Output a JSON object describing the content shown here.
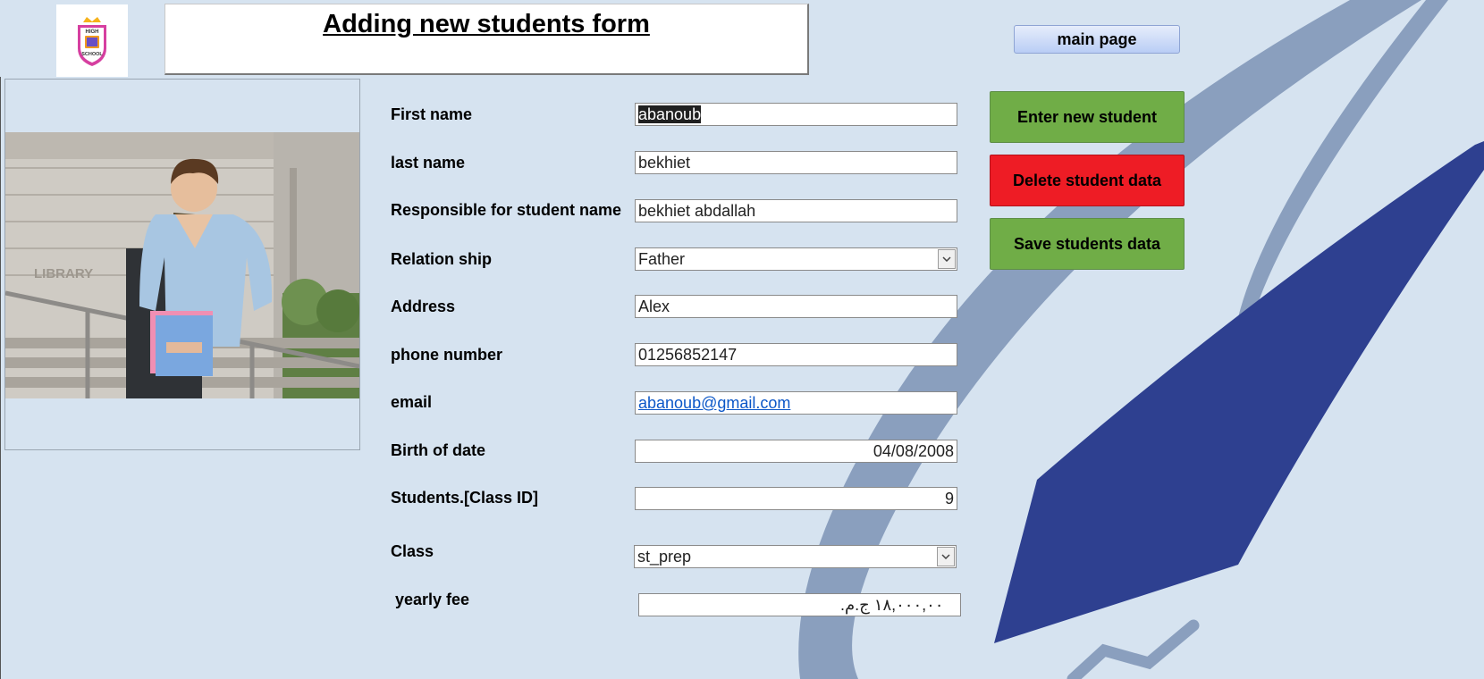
{
  "header": {
    "logo_text_top": "HIGH",
    "logo_text_bottom": "SCHOOL",
    "title": "Adding new students form",
    "main_page_label": "main page"
  },
  "photo": {
    "sign_text": "LIBRARY"
  },
  "form": {
    "first_name": {
      "label": "First name",
      "value": "abanoub"
    },
    "last_name": {
      "label": "last name",
      "value": "bekhiet"
    },
    "responsible": {
      "label": "Responsible for student name",
      "value": "bekhiet abdallah"
    },
    "relationship": {
      "label": "Relation ship",
      "value": "Father"
    },
    "address": {
      "label": "Address",
      "value": "Alex"
    },
    "phone": {
      "label": "phone number",
      "value": "01256852147"
    },
    "email": {
      "label": "email",
      "value": "abanoub@gmail.com"
    },
    "birth_date": {
      "label": "Birth of date",
      "value": "04/08/2008"
    },
    "class_id": {
      "label": "Students.[Class ID]",
      "value": "9"
    },
    "class": {
      "label": "Class",
      "value": "st_prep"
    },
    "yearly_fee": {
      "label": "yearly fee",
      "value": "١٨,٠٠٠,٠٠ ج.م."
    }
  },
  "actions": {
    "enter_new": "Enter new student",
    "delete": "Delete student data",
    "save": "Save students data"
  },
  "colors": {
    "background": "#d6e3f0",
    "navy_shape": "#2e4090",
    "swoosh": "#8a9fbe",
    "green_button": "#70ad47",
    "red_button": "#ee1c25"
  }
}
